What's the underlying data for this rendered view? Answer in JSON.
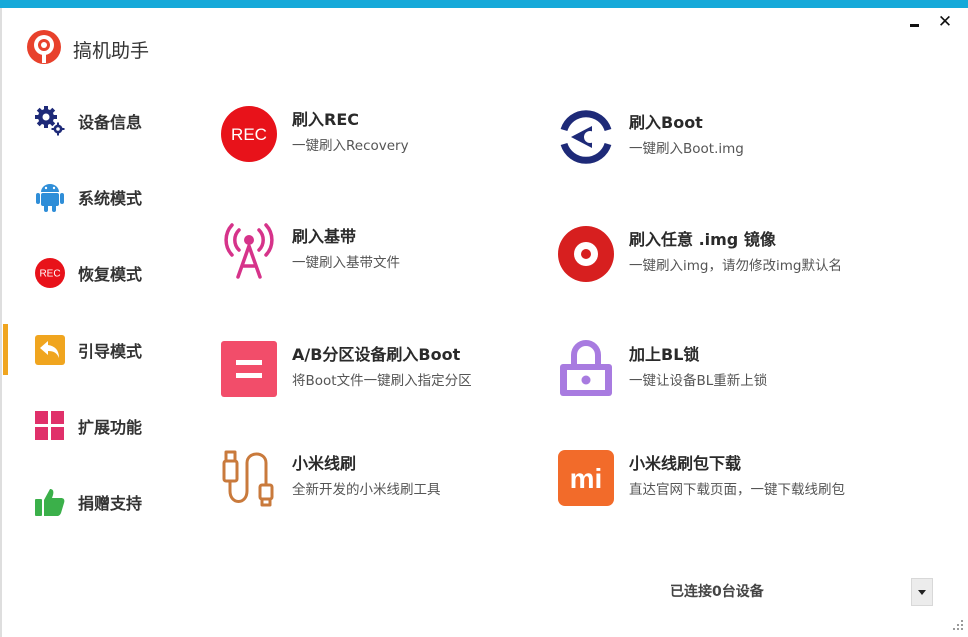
{
  "app": {
    "title": "搞机助手"
  },
  "sidebar": {
    "items": [
      {
        "label": "设备信息",
        "icon": "gears-icon"
      },
      {
        "label": "系统模式",
        "icon": "android-icon"
      },
      {
        "label": "恢复模式",
        "icon": "rec-icon"
      },
      {
        "label": "引导模式",
        "icon": "return-arrow-icon"
      },
      {
        "label": "扩展功能",
        "icon": "grid-icon"
      },
      {
        "label": "捐赠支持",
        "icon": "thumbs-up-icon"
      }
    ],
    "active_index": 3,
    "rec_icon_text": "REC"
  },
  "cards": [
    {
      "title": "刷入REC",
      "desc": "一键刷入Recovery",
      "icon": "rec-badge-icon",
      "icon_text": "REC"
    },
    {
      "title": "刷入Boot",
      "desc": "一键刷入Boot.img",
      "icon": "boot-ring-icon"
    },
    {
      "title": "刷入基带",
      "desc": "一键刷入基带文件",
      "icon": "antenna-tower-icon"
    },
    {
      "title": "刷入任意 .img 镜像",
      "desc": "一键刷入img，请勿修改img默认名",
      "icon": "disc-icon"
    },
    {
      "title": "A/B分区设备刷入Boot",
      "desc": "将Boot文件一键刷入指定分区",
      "icon": "ab-partition-icon"
    },
    {
      "title": "加上BL锁",
      "desc": "一键让设备BL重新上锁",
      "icon": "padlock-icon"
    },
    {
      "title": "小米线刷",
      "desc": "全新开发的小米线刷工具",
      "icon": "usb-cable-icon"
    },
    {
      "title": "小米线刷包下载",
      "desc": "直达官网下载页面，一键下载线刷包",
      "icon": "mi-logo-icon",
      "icon_text": "mi"
    }
  ],
  "status": {
    "text": "已连接0台设备"
  },
  "colors": {
    "top_bar": "#16a9d9",
    "active_indicator": "#f0a51f",
    "rec_red": "#e8121a",
    "boot_navy": "#1e2a78",
    "antenna_pink": "#d6338a",
    "disc_red": "#d71f1f",
    "ab_pink": "#f24d6a",
    "lock_purple": "#a87be0",
    "usb_orange": "#c97a3c",
    "mi_orange": "#f26b2a"
  }
}
